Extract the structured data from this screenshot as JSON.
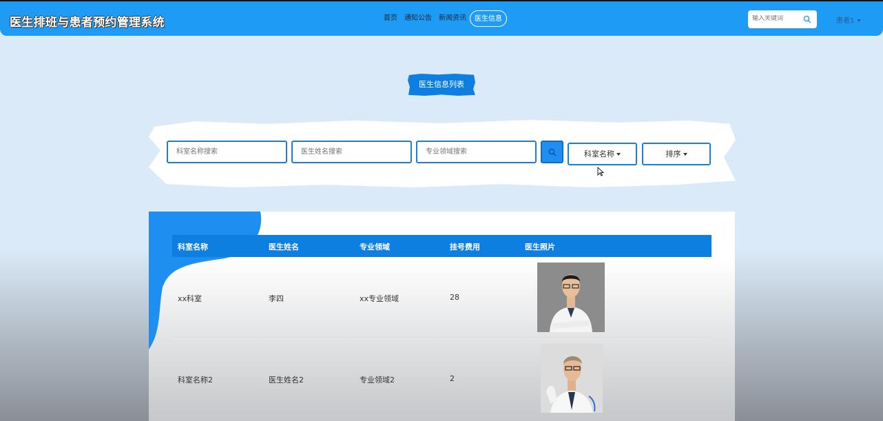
{
  "header": {
    "brand": "医生排班与患者预约管理系统",
    "nav": [
      {
        "label": "首页"
      },
      {
        "label": "通知公告"
      },
      {
        "label": "新闻资讯"
      },
      {
        "label": "医生信息",
        "active": true
      }
    ],
    "search_placeholder": "输入关键词",
    "user": "患者1"
  },
  "page": {
    "section_title": "医生信息列表"
  },
  "filters": {
    "dept_placeholder": "科室名称搜索",
    "doctor_placeholder": "医生姓名搜索",
    "field_placeholder": "专业领域搜索",
    "dept_dropdown": "科室名称",
    "sort_dropdown": "排序"
  },
  "table": {
    "headers": [
      "科室名称",
      "医生姓名",
      "专业领域",
      "挂号费用",
      "医生照片"
    ],
    "rows": [
      {
        "dept": "xx科室",
        "name": "李四",
        "field": "xx专业领域",
        "fee": "28"
      },
      {
        "dept": "科室名称2",
        "name": "医生姓名2",
        "field": "专业领域2",
        "fee": "2"
      }
    ]
  },
  "colors": {
    "primary": "#1e9bf5",
    "accent": "#0d7fe0",
    "background": "#dbeaf8"
  }
}
